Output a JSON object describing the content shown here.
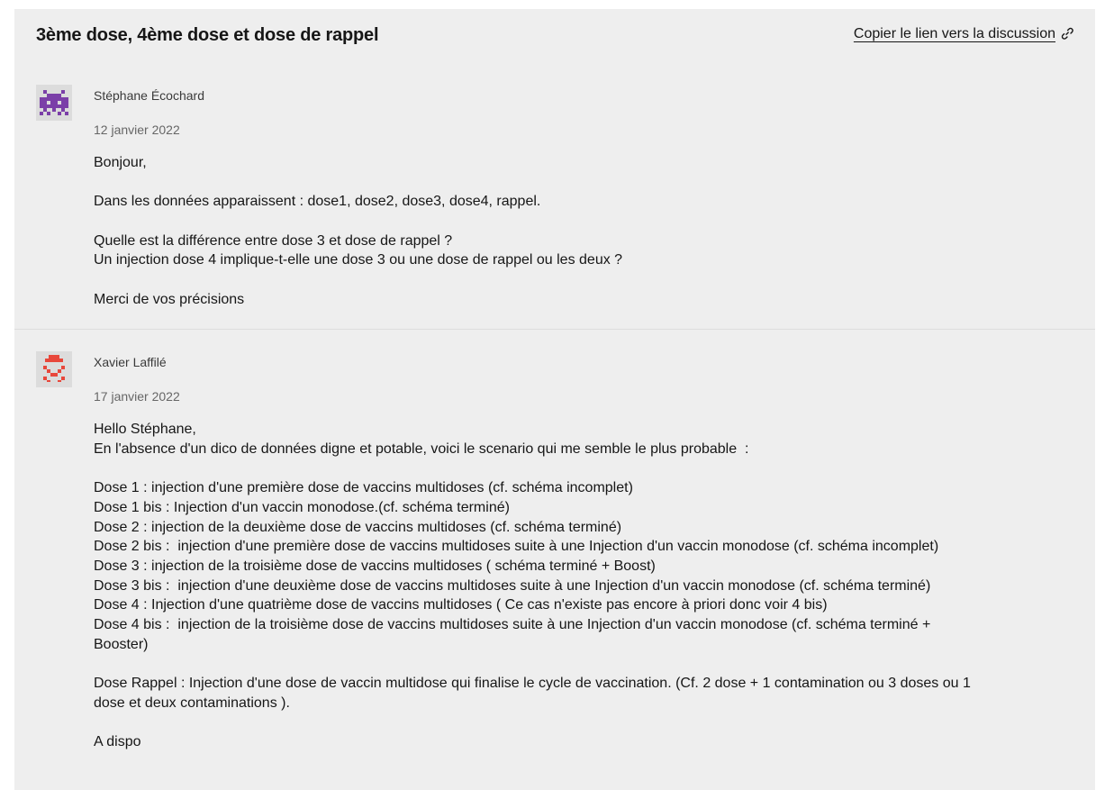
{
  "discussion": {
    "title": "3ème dose, 4ème dose et dose de rappel",
    "copy_link_label": "Copier le lien vers la discussion",
    "copy_link_icon": "link-icon"
  },
  "messages": [
    {
      "author": "Stéphane Écochard",
      "date": "12 janvier 2022",
      "avatar_icon": "pixel-invader-avatar",
      "avatar_color": "#7b3fa8",
      "paragraphs": [
        "Bonjour,",
        "Dans les données apparaissent : dose1, dose2, dose3, dose4, rappel.",
        "Quelle est la différence entre dose 3 et dose de rappel ?\nUn injection dose 4 implique-t-elle une dose 3 ou une dose de rappel ou les deux ?",
        "Merci de vos précisions"
      ]
    },
    {
      "author": "Xavier Laffilé",
      "date": "17 janvier 2022",
      "avatar_icon": "pixel-face-avatar",
      "avatar_color": "#e8473b",
      "paragraphs": [
        "Hello Stéphane,\nEn l'absence d'un dico de données digne et potable, voici le scenario qui me semble le plus probable  :",
        "Dose 1 : injection d'une première dose de vaccins multidoses (cf. schéma incomplet)\nDose 1 bis : Injection d'un vaccin monodose.(cf. schéma terminé)\nDose 2 : injection de la deuxième dose de vaccins multidoses (cf. schéma terminé)\nDose 2 bis :  injection d'une première dose de vaccins multidoses suite à une Injection d'un vaccin monodose (cf. schéma incomplet)\nDose 3 : injection de la troisième dose de vaccins multidoses ( schéma terminé + Boost)\nDose 3 bis :  injection d'une deuxième dose de vaccins multidoses suite à une Injection d'un vaccin monodose (cf. schéma terminé)\nDose 4 : Injection d'une quatrième dose de vaccins multidoses ( Ce cas n'existe pas encore à priori donc voir 4 bis)\nDose 4 bis :  injection de la troisième dose de vaccins multidoses suite à une Injection d'un vaccin monodose (cf. schéma terminé +\nBooster)",
        "Dose Rappel : Injection d'une dose de vaccin multidose qui finalise le cycle de vaccination. (Cf. 2 dose + 1 contamination ou 3 doses ou 1\ndose et deux contaminations ).",
        "A dispo"
      ]
    }
  ]
}
